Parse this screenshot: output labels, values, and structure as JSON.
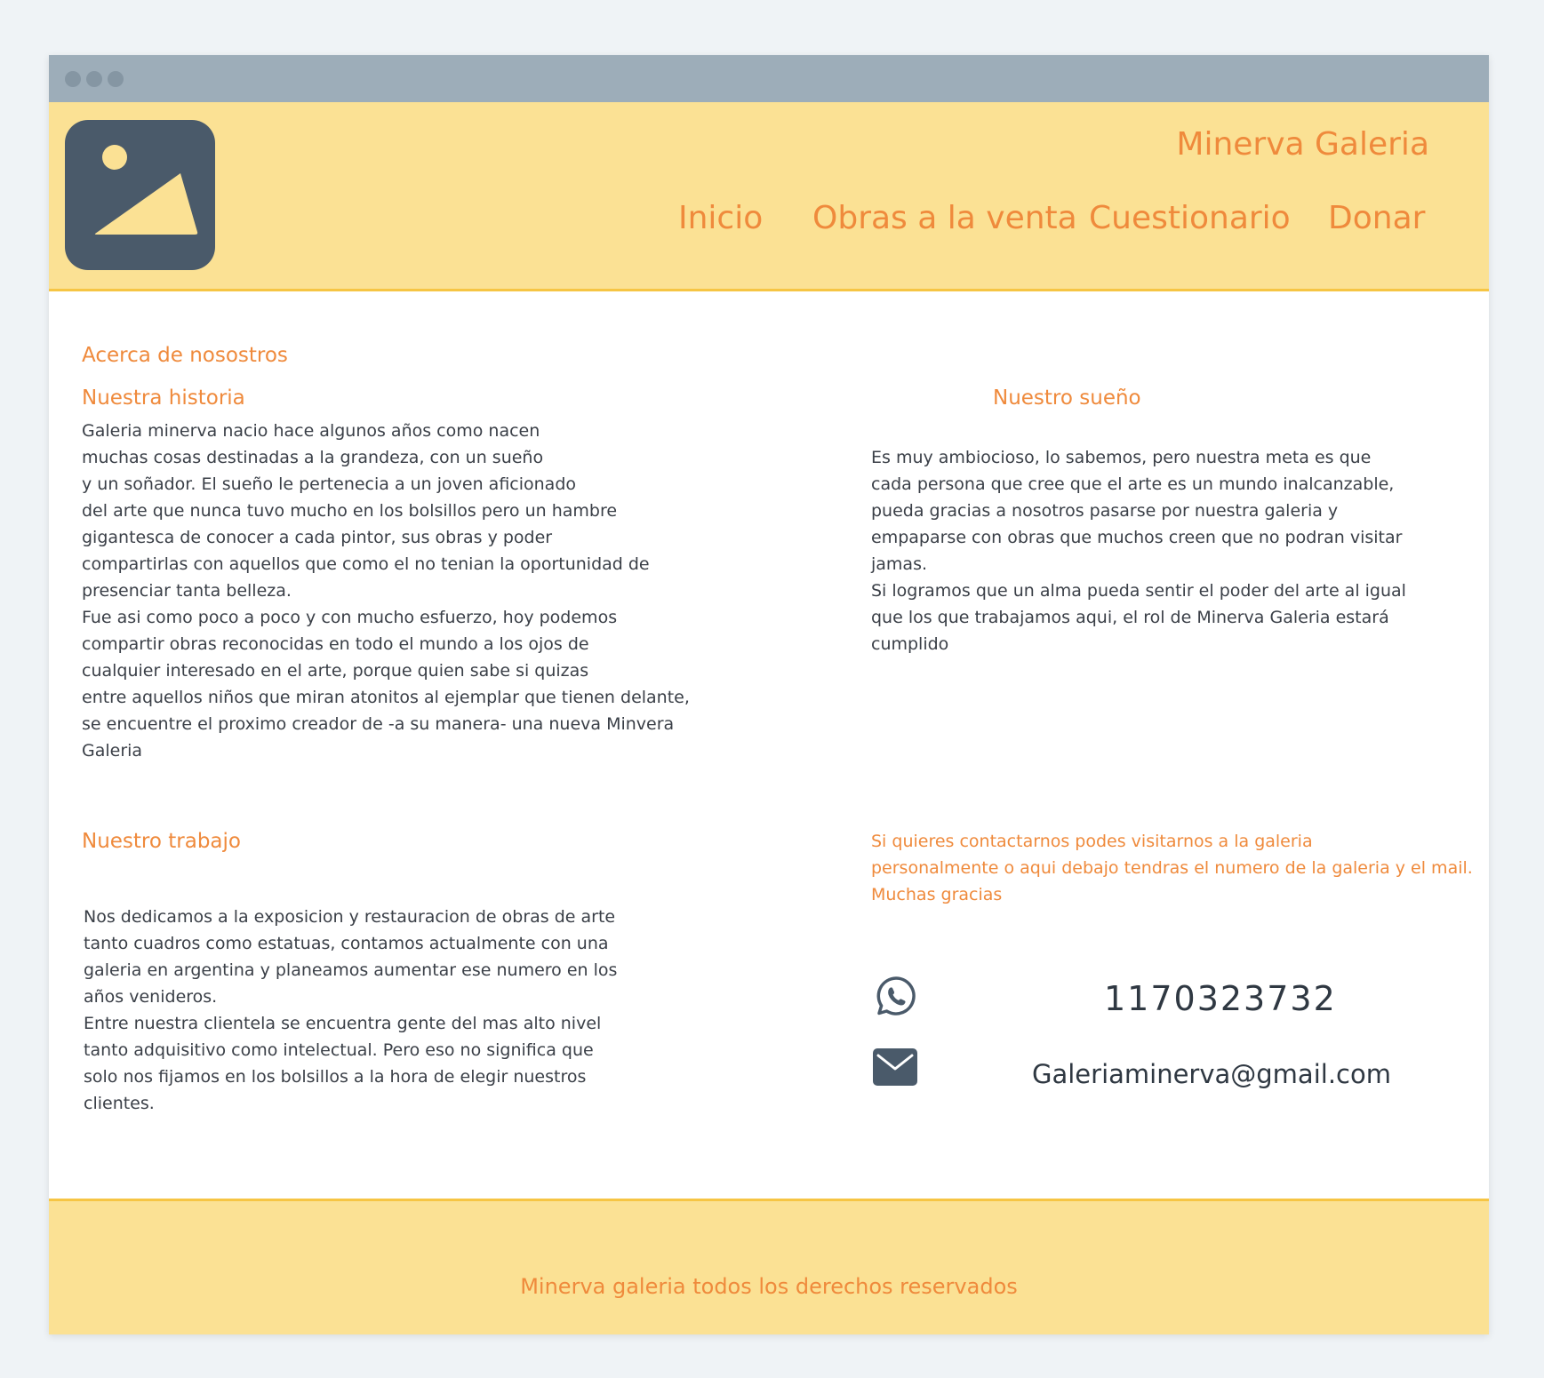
{
  "header": {
    "site_title": "Minerva Galeria",
    "logo_icon": "image-placeholder-icon",
    "nav": [
      {
        "label": "Inicio"
      },
      {
        "label": "Obras a la venta"
      },
      {
        "label": "Cuestionario"
      },
      {
        "label": "Donar"
      }
    ]
  },
  "about": {
    "heading": "Acerca de nosostros",
    "history": {
      "title": "Nuestra historia",
      "text": "Galeria minerva nacio hace algunos años como nacen\nmuchas cosas destinadas a la grandeza, con un sueño\ny un soñador. El sueño le pertenecia a un joven aficionado\ndel arte que nunca tuvo mucho en los bolsillos pero un hambre\ngigantesca de conocer a cada pintor, sus obras y poder\ncompartirlas con aquellos que como el no tenian la oportunidad de\npresenciar tanta belleza.\nFue asi como poco a poco y con mucho esfuerzo, hoy podemos\ncompartir obras reconocidas en todo el mundo a los ojos de\ncualquier interesado en el arte, porque quien sabe si quizas\nentre aquellos niños que miran atonitos al ejemplar que tienen delante,\nse encuentre el proximo creador de -a su manera- una nueva Minvera\nGaleria"
    },
    "dream": {
      "title": "Nuestro sueño",
      "text": "Es muy ambiocioso, lo sabemos, pero nuestra meta es que\ncada persona que cree que el arte es un mundo inalcanzable,\npueda gracias a nosotros pasarse por nuestra galeria y\nempaparse con obras que muchos creen que no podran visitar\njamas.\nSi logramos que un alma pueda sentir el poder del arte al igual\nque los que trabajamos aqui, el rol de Minerva Galeria estará\ncumplido"
    },
    "work": {
      "title": "Nuestro trabajo",
      "text": "Nos dedicamos a la exposicion y restauracion de obras de arte\ntanto cuadros como estatuas, contamos actualmente con una\ngaleria en argentina y planeamos aumentar ese numero en los\naños venideros.\nEntre nuestra clientela se encuentra gente del mas alto nivel\ntanto adquisitivo como intelectual. Pero eso no significa que\nsolo nos fijamos en los bolsillos a la hora de elegir nuestros\nclientes."
    }
  },
  "contact": {
    "message": "Si quieres contactarnos podes visitarnos a la galeria\npersonalmente o aqui debajo tendras el numero de la galeria y el mail.\nMuchas gracias",
    "phone_icon": "whatsapp-icon",
    "phone": "1170323732",
    "email_icon": "envelope-icon",
    "email": "Galeriaminerva@gmail.com"
  },
  "footer": {
    "text": "Minerva galeria todos los derechos reservados"
  },
  "colors": {
    "accent": "#ef8a3c",
    "header_bg": "#fbe194",
    "border": "#f6c544",
    "logo_bg": "#4a5a6a"
  }
}
